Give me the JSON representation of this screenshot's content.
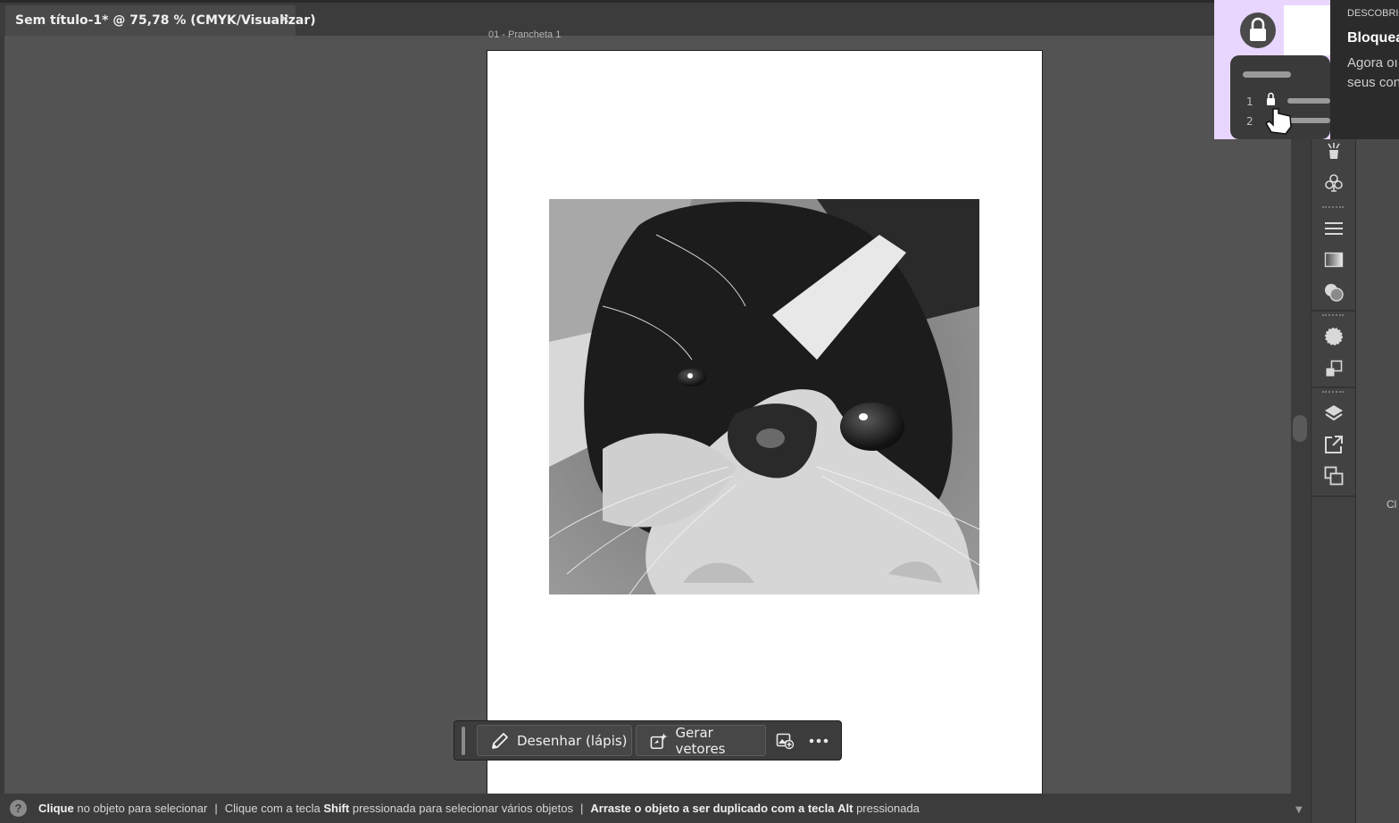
{
  "document_tab": {
    "title": "Sem título-1* @ 75,78 % (CMYK/Visualizar)",
    "close_glyph": "✕"
  },
  "artboard": {
    "label": "01 - Prancheta 1"
  },
  "contextual_toolbar": {
    "draw_label": "Desenhar (lápis)",
    "draw_icon": "pencil-icon",
    "generate_label": "Gerar vetores",
    "generate_icon": "generate-vectors-icon",
    "image_icon": "image-options-icon",
    "more_icon": "more-icon"
  },
  "status_bar": {
    "help_glyph": "?",
    "hint1_bold": "Clique",
    "hint1_rest": "no objeto para selecionar",
    "hint2_start": "Clique com a tecla",
    "hint2_bold": "Shift",
    "hint2_rest": "pressionada para selecionar vários objetos",
    "hint3_bold": "Arraste o objeto a ser duplicado com a tecla",
    "hint3_bold2": "Alt",
    "hint3_rest": "pressionada",
    "separator": "|"
  },
  "promo": {
    "kicker": "DESCOBRIR",
    "title": "Bloquea",
    "body_line1": "Agora oı",
    "body_line2": "seus con",
    "list_numbers": [
      "1",
      "2"
    ]
  },
  "right_panel": {
    "clipped_label": "Cl"
  },
  "panel_icons": [
    "puppet-warp-icon",
    "symbols-icon",
    "align-icon",
    "gradient-icon",
    "transparency-icon",
    "appearance-icon",
    "transform-icon",
    "layers-icon",
    "export-icon",
    "artboards-icon"
  ],
  "colors": {
    "canvas": "#535353",
    "chrome": "#3c3c3c",
    "artboard": "#ffffff",
    "promo_accent": "#e9d6ff"
  }
}
